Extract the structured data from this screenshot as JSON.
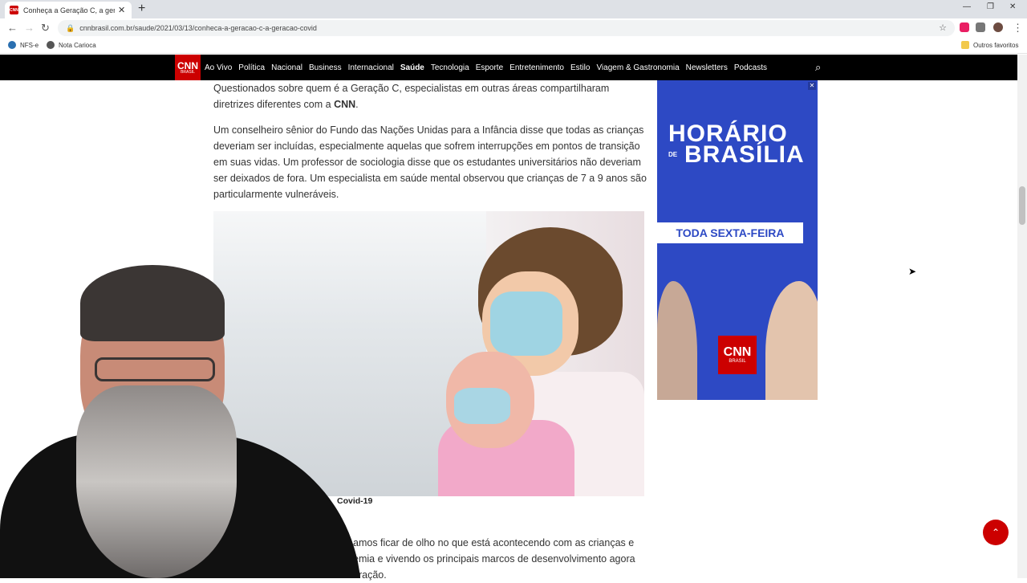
{
  "browser": {
    "tab_title": "Conheça a Geração C, a geração",
    "url": "cnnbrasil.com.br/saude/2021/03/13/conheca-a-geracao-c-a-geracao-covid",
    "bookmarks": [
      "NFS-e",
      "Nota Carioca"
    ],
    "other_bookmarks": "Outros favoritos"
  },
  "site": {
    "logo": "CNN",
    "logo_sub": "BRASIL",
    "nav": [
      "Ao Vivo",
      "Política",
      "Nacional",
      "Business",
      "Internacional",
      "Saúde",
      "Tecnologia",
      "Esporte",
      "Entretenimento",
      "Estilo",
      "Viagem & Gastronomia",
      "Newsletters",
      "Podcasts"
    ],
    "active_nav": "Saúde"
  },
  "article": {
    "p1_text": "Questionados sobre quem é a Geração C, especialistas em outras áreas compartilharam diretrizes diferentes com a ",
    "p1_bold": "CNN",
    "p1_end": ".",
    "p2": "Um conselheiro sênior do Fundo das Nações Unidas para a Infância disse que todas as crianças deveriam ser incluídas, especialmente aquelas que sofrem interrupções em pontos de transição em suas vidas. Um professor de sociologia disse que os estudantes universitários não deveriam ser deixados de fora. Um especialista em saúde mental observou que crianças de 7 a 9 anos são particularmente vulneráveis.",
    "caption": "Covid-19",
    "p3_visible": "amos ficar de olho no que está acontecendo com as crianças e emia e vivendo os principais marcos de desenvolvimento agora eração."
  },
  "ad": {
    "close": "✕",
    "line1": "HORÁRIO",
    "line_de": "DE",
    "line2": "BRASÍLIA",
    "band": "TODA SEXTA-FEIRA",
    "logo": "CNN",
    "logo_sub": "BRASIL"
  },
  "colors": {
    "cnn_red": "#cc0000",
    "ad_blue": "#2d49c4"
  }
}
